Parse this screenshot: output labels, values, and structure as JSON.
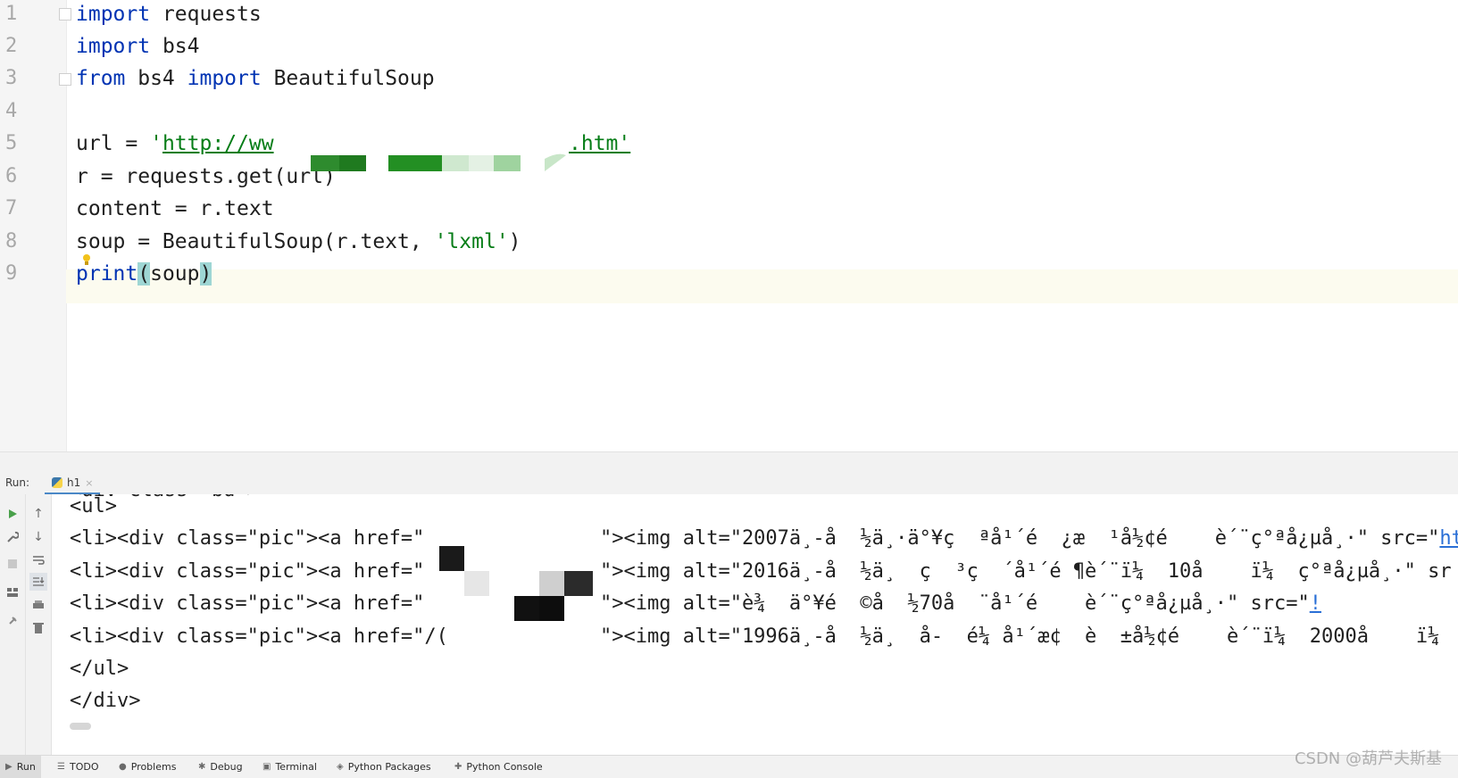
{
  "editor": {
    "line_numbers": [
      "1",
      "2",
      "3",
      "4",
      "5",
      "6",
      "7",
      "8",
      "9"
    ],
    "lines": [
      {
        "parts": [
          {
            "t": "import",
            "c": "kw"
          },
          {
            "t": " requests",
            "c": ""
          }
        ]
      },
      {
        "parts": [
          {
            "t": "import",
            "c": "kw"
          },
          {
            "t": " bs4",
            "c": ""
          }
        ]
      },
      {
        "parts": [
          {
            "t": "from",
            "c": "kw"
          },
          {
            "t": " bs4 ",
            "c": ""
          },
          {
            "t": "import",
            "c": "kw"
          },
          {
            "t": " BeautifulSoup",
            "c": ""
          }
        ]
      },
      {
        "parts": []
      },
      {
        "parts": [
          {
            "t": "url = ",
            "c": ""
          },
          {
            "t": "'",
            "c": "str"
          },
          {
            "t": "http://ww",
            "c": "str url"
          }
        ]
      },
      {
        "parts": [
          {
            "t": "r = requests.get(url)",
            "c": ""
          }
        ]
      },
      {
        "parts": [
          {
            "t": "content = r.text",
            "c": ""
          }
        ]
      },
      {
        "parts": [
          {
            "t": "soup = BeautifulSoup(r.text, ",
            "c": ""
          },
          {
            "t": "'lxml'",
            "c": "str"
          },
          {
            "t": ")",
            "c": ""
          }
        ]
      },
      {
        "parts": [
          {
            "t": "print",
            "c": "kw"
          },
          {
            "t": "(",
            "c": "brace"
          },
          {
            "t": "soup",
            "c": ""
          },
          {
            "t": ")",
            "c": "brace"
          }
        ]
      }
    ],
    "url_tail": ".htm'"
  },
  "run_panel": {
    "run_label": "Run:",
    "tab_label": "h1",
    "close_glyph": "×",
    "console_lines": [
      "<div class=\"bd\">",
      "<ul>",
      "<li><div class=\"pic\"><a href=\"",
      "<li><div class=\"pic\"><a href=\"",
      "<li><div class=\"pic\"><a href=\"",
      "<li><div class=\"pic\"><a href=\"/(",
      "</ul>",
      "</div>"
    ],
    "console_tails": [
      "\"><img alt=\"2007ä¸-å  ½ä¸·ä°¥ç  ªå¹´é  ¿æ  ¹å½¢é    è´¨ç°ªå¿µå¸·\" src=\"",
      "\"><img alt=\"2016ä¸-å  ½ä¸  ç  ³ç  ´å¹´é ¶è´¨ï¼  10å    ï¼  ç°ªå¿µå¸·\" sr",
      "\"><img alt=\"è¾  ä°¥é  ©å  ½70å  ¨å¹´é    è´¨ç°ªå¿µå¸·\" src=\"",
      "\"><img alt=\"1996ä¸-å  ½ä¸  å-  é¼ å¹´æ¢  è  ±å½¢é    è´¨ï¼  2000å    ï¼  ç"
    ],
    "console_link_tails": [
      "ht",
      "",
      "!",
      ""
    ]
  },
  "bottom_bar": {
    "items": [
      {
        "label": "Run",
        "icon": "run-icon"
      },
      {
        "label": "TODO",
        "icon": "list-icon"
      },
      {
        "label": "Problems",
        "icon": "problems-icon"
      },
      {
        "label": "Debug",
        "icon": "bug-icon"
      },
      {
        "label": "Terminal",
        "icon": "terminal-icon"
      },
      {
        "label": "Python Packages",
        "icon": "packages-icon"
      },
      {
        "label": "Python Console",
        "icon": "python-console-icon"
      }
    ],
    "watermark": "CSDN @葫芦夫斯基"
  },
  "colors": {
    "keyword": "#0033b3",
    "string": "#067d17",
    "link": "#2a6fd6",
    "brace_match": "#9ed6d4"
  }
}
